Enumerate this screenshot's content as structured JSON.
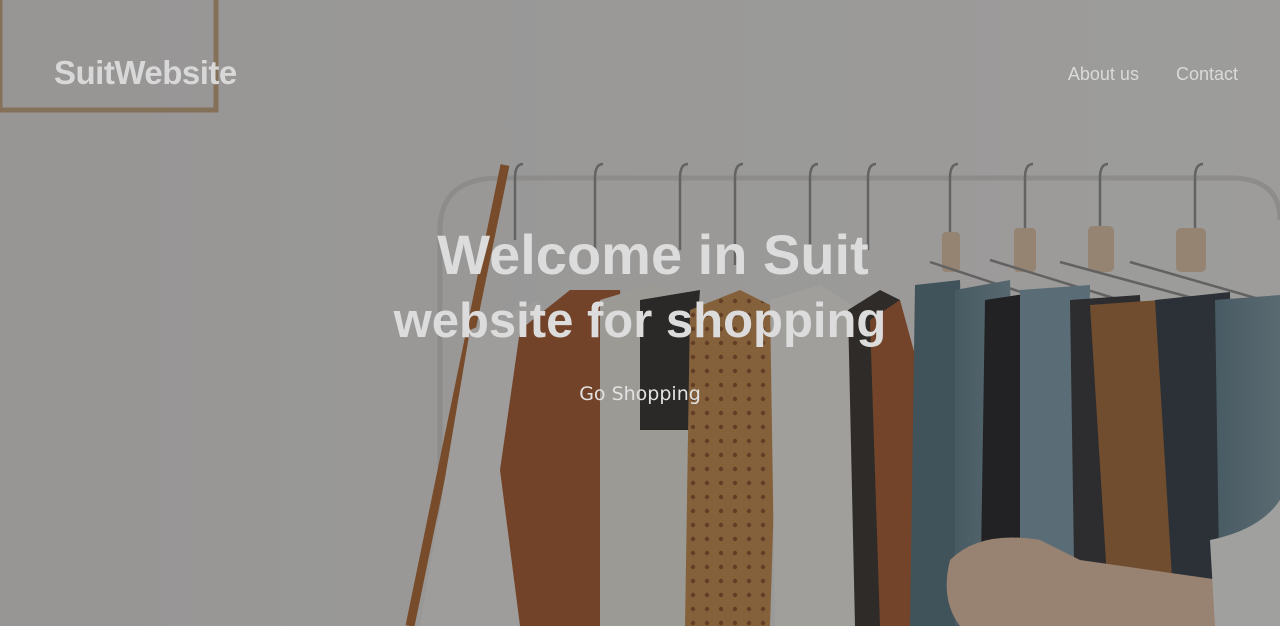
{
  "header": {
    "logo": "SuitWebsite",
    "nav": [
      {
        "label": "About us"
      },
      {
        "label": "Contact"
      }
    ]
  },
  "hero": {
    "title_line1": "Welcome in Suit",
    "title_line2": "website for shopping",
    "cta_label": "Go Shopping"
  }
}
